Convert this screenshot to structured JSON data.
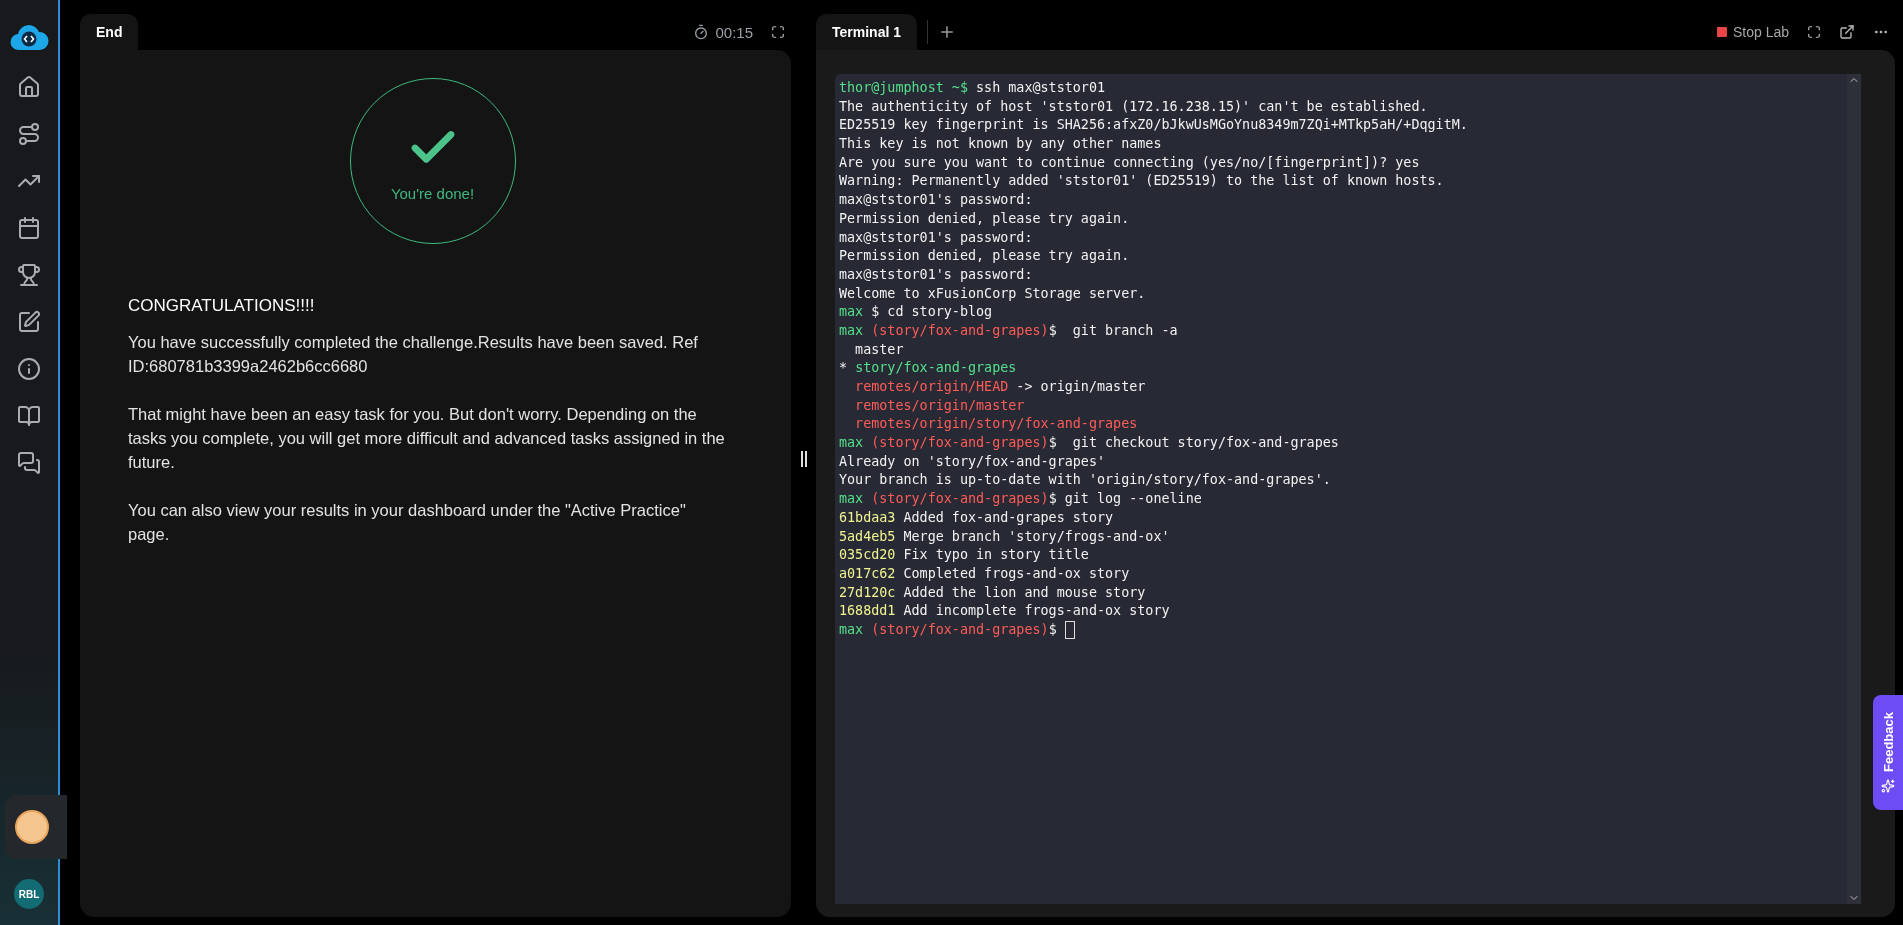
{
  "sidebar": {
    "avatar_initials": "RBL"
  },
  "left_panel": {
    "tabs": [
      {
        "label": "End",
        "selected": true
      }
    ],
    "timer": "00:15",
    "status": "You're done!",
    "heading": "CONGRATULATIONS!!!!",
    "paragraphs": [
      "You have successfully completed the challenge.Results have been saved. Ref ID:680781b3399a2462b6cc6680",
      "That might have been an easy task for you. But don't worry. Depending on the tasks you complete, you will get more difficult and advanced tasks assigned in the future.",
      "You can also view your results in your dashboard under the \"Active Practice\" page."
    ]
  },
  "right_panel": {
    "tabs": [
      {
        "label": "Terminal 1",
        "selected": true
      }
    ],
    "stop_button": "Stop Lab",
    "terminal": {
      "cursor_visible": true,
      "lines": [
        [
          {
            "text": "thor@jumphost ~$",
            "color": "#55e08a"
          },
          {
            "text": " ssh max@ststor01",
            "color": "#f2f2f2"
          }
        ],
        [
          {
            "text": "The authenticity of host 'ststor01 (172.16.238.15)' can't be established.",
            "color": "#f2f2f2"
          }
        ],
        [
          {
            "text": "ED25519 key fingerprint is SHA256:afxZ0/bJkwUsMGoYnu8349m7ZQi+MTkp5aH/+DqgitM.",
            "color": "#f2f2f2"
          }
        ],
        [
          {
            "text": "This key is not known by any other names",
            "color": "#f2f2f2"
          }
        ],
        [
          {
            "text": "Are you sure you want to continue connecting (yes/no/[fingerprint])? yes",
            "color": "#f2f2f2"
          }
        ],
        [
          {
            "text": "Warning: Permanently added 'ststor01' (ED25519) to the list of known hosts.",
            "color": "#f2f2f2"
          }
        ],
        [
          {
            "text": "max@ststor01's password:",
            "color": "#f2f2f2"
          }
        ],
        [
          {
            "text": "Permission denied, please try again.",
            "color": "#f2f2f2"
          }
        ],
        [
          {
            "text": "max@ststor01's password:",
            "color": "#f2f2f2"
          }
        ],
        [
          {
            "text": "Permission denied, please try again.",
            "color": "#f2f2f2"
          }
        ],
        [
          {
            "text": "max@ststor01's password:",
            "color": "#f2f2f2"
          }
        ],
        [
          {
            "text": "Welcome to xFusionCorp Storage server.",
            "color": "#f2f2f2"
          }
        ],
        [
          {
            "text": "max",
            "color": "#55e08a"
          },
          {
            "text": " $ cd story-blog",
            "color": "#f2f2f2"
          }
        ],
        [
          {
            "text": "max",
            "color": "#55e08a"
          },
          {
            "text": " (story/fox-and-grapes)",
            "color": "#ff5c57"
          },
          {
            "text": "$  git branch -a",
            "color": "#f2f2f2"
          }
        ],
        [
          {
            "text": "  master",
            "color": "#f2f2f2"
          }
        ],
        [
          {
            "text": "* "
          },
          {
            "text": "story/fox-and-grapes",
            "color": "#55e08a"
          }
        ],
        [
          {
            "text": "  remotes/origin/HEAD",
            "color": "#ff5c57"
          },
          {
            "text": " -> origin/master",
            "color": "#f2f2f2"
          }
        ],
        [
          {
            "text": "  remotes/origin/master",
            "color": "#ff5c57"
          }
        ],
        [
          {
            "text": "  remotes/origin/story/fox-and-grapes",
            "color": "#ff5c57"
          }
        ],
        [
          {
            "text": "max",
            "color": "#55e08a"
          },
          {
            "text": " (story/fox-and-grapes)",
            "color": "#ff5c57"
          },
          {
            "text": "$  git checkout story/fox-and-grapes",
            "color": "#f2f2f2"
          }
        ],
        [
          {
            "text": "Already on 'story/fox-and-grapes'",
            "color": "#f2f2f2"
          }
        ],
        [
          {
            "text": "Your branch is up-to-date with 'origin/story/fox-and-grapes'.",
            "color": "#f2f2f2"
          }
        ],
        [
          {
            "text": "max",
            "color": "#55e08a"
          },
          {
            "text": " (story/fox-and-grapes)",
            "color": "#ff5c57"
          },
          {
            "text": "$ git log --oneline",
            "color": "#f2f2f2"
          }
        ],
        [
          {
            "text": "61bdaa3",
            "color": "#f1f58f"
          },
          {
            "text": " Added fox-and-grapes story",
            "color": "#f2f2f2"
          }
        ],
        [
          {
            "text": "5ad4eb5",
            "color": "#f1f58f"
          },
          {
            "text": " Merge branch 'story/frogs-and-ox'",
            "color": "#f2f2f2"
          }
        ],
        [
          {
            "text": "035cd20",
            "color": "#f1f58f"
          },
          {
            "text": " Fix typo in story title",
            "color": "#f2f2f2"
          }
        ],
        [
          {
            "text": "a017c62",
            "color": "#f1f58f"
          },
          {
            "text": " Completed frogs-and-ox story",
            "color": "#f2f2f2"
          }
        ],
        [
          {
            "text": "27d120c",
            "color": "#f1f58f"
          },
          {
            "text": " Added the lion and mouse story",
            "color": "#f2f2f2"
          }
        ],
        [
          {
            "text": "1688dd1",
            "color": "#f1f58f"
          },
          {
            "text": " Add incomplete frogs-and-ox story",
            "color": "#f2f2f2"
          }
        ],
        [
          {
            "text": "max",
            "color": "#55e08a"
          },
          {
            "text": " (story/fox-and-grapes)",
            "color": "#ff5c57"
          },
          {
            "text": "$",
            "color": "#f2f2f2"
          }
        ]
      ]
    }
  },
  "feedback_tab": "Feedback"
}
